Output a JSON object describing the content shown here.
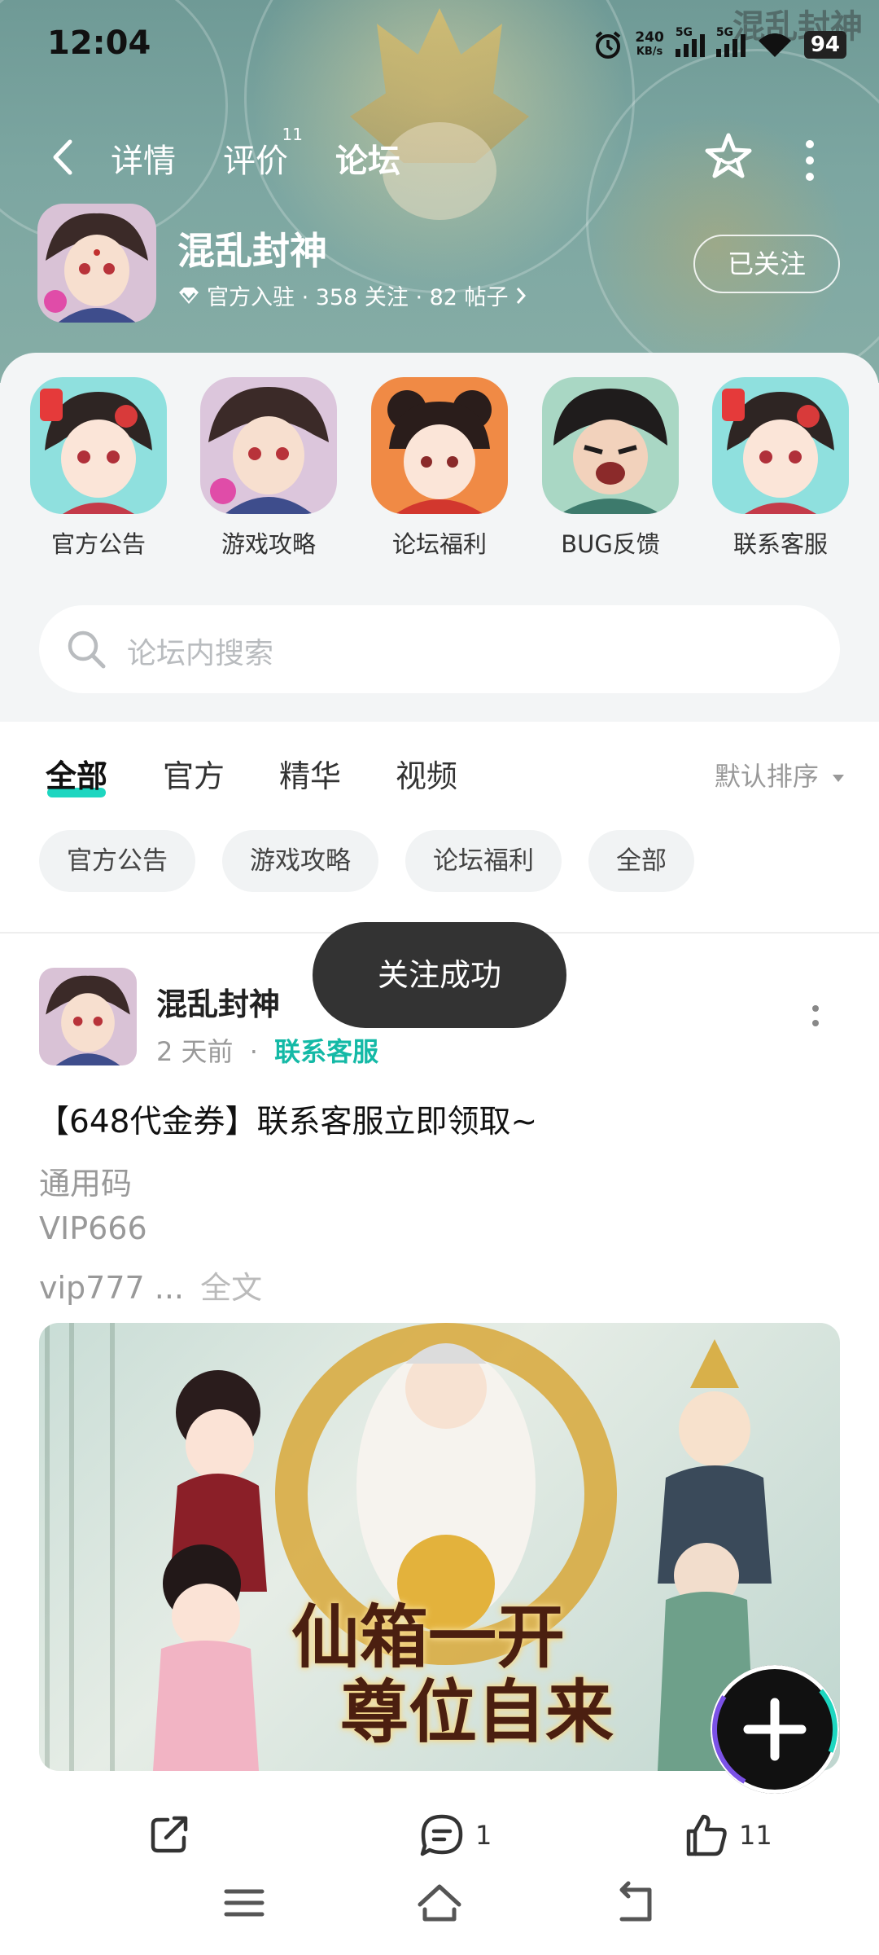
{
  "status_bar": {
    "time": "12:04",
    "net_speed_value": "240",
    "net_speed_unit": "KB/s",
    "sim1": "5G",
    "sim2": "5G",
    "battery": "94"
  },
  "nav": {
    "tabs": [
      {
        "label": "详情"
      },
      {
        "label": "评价",
        "badge": "11"
      },
      {
        "label": "论坛"
      }
    ],
    "active_tab": "论坛"
  },
  "game": {
    "name": "混乱封神",
    "meta": "官方入驻 · 358 关注 · 82 帖子",
    "follow_button": "已关注",
    "banner_logo": "混乱封神"
  },
  "quick_links": [
    {
      "label": "官方公告"
    },
    {
      "label": "游戏攻略"
    },
    {
      "label": "论坛福利"
    },
    {
      "label": "BUG反馈"
    },
    {
      "label": "联系客服"
    }
  ],
  "search": {
    "placeholder": "论坛内搜索"
  },
  "filter_tabs": [
    {
      "label": "全部"
    },
    {
      "label": "官方"
    },
    {
      "label": "精华"
    },
    {
      "label": "视频"
    }
  ],
  "sort_label": "默认排序",
  "chips": [
    "官方公告",
    "游戏攻略",
    "论坛福利",
    "全部"
  ],
  "post": {
    "author": "混乱封神",
    "time": "2 天前",
    "category": "联系客服",
    "title": "【648代金券】联系客服立即领取~",
    "lines": [
      "通用码",
      "VIP666",
      "vip777 ..."
    ],
    "full_text_label": "全文",
    "image_text_1": "仙箱一开",
    "image_text_2": "尊位自来",
    "comment_count": "1",
    "like_count": "11"
  },
  "toast": "关注成功",
  "colors": {
    "accent": "#1dd6c0",
    "category": "#14b9a6",
    "toast_bg": "#333333"
  }
}
